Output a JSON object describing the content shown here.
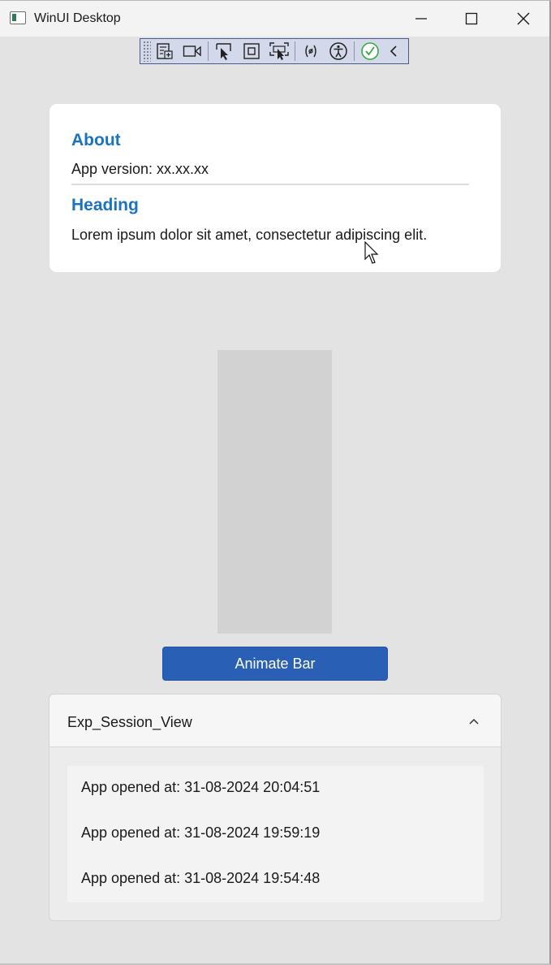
{
  "window": {
    "title": "WinUI Desktop",
    "caption_buttons": [
      "minimize-icon",
      "maximize-icon",
      "close-icon"
    ]
  },
  "debug_toolbar": {
    "icons": [
      "grip-handle",
      "live-visual-tree-icon",
      "record-icon",
      "select-element-icon",
      "display-layout-adorners-icon",
      "track-focus-icon",
      "binding-failures-icon",
      "accessibility-icon",
      "check-icon",
      "collapse-chevron-icon"
    ],
    "check_color": "#3aa845"
  },
  "about": {
    "heading": "About",
    "version": "App version: xx.xx.xx",
    "section_heading": "Heading",
    "body": "Lorem ipsum dolor sit amet, consectetur adipiscing elit."
  },
  "animate_button": {
    "label": "Animate Bar",
    "color": "#2a5fb6"
  },
  "session_expander": {
    "title": "Exp_Session_View",
    "expanded": true,
    "items": [
      "App opened at: 31-08-2024 20:04:51",
      "App opened at: 31-08-2024 19:59:19",
      "App opened at: 31-08-2024 19:54:48"
    ]
  },
  "colors": {
    "accent_heading": "#1a73c0",
    "background": "#e3e3e3"
  }
}
